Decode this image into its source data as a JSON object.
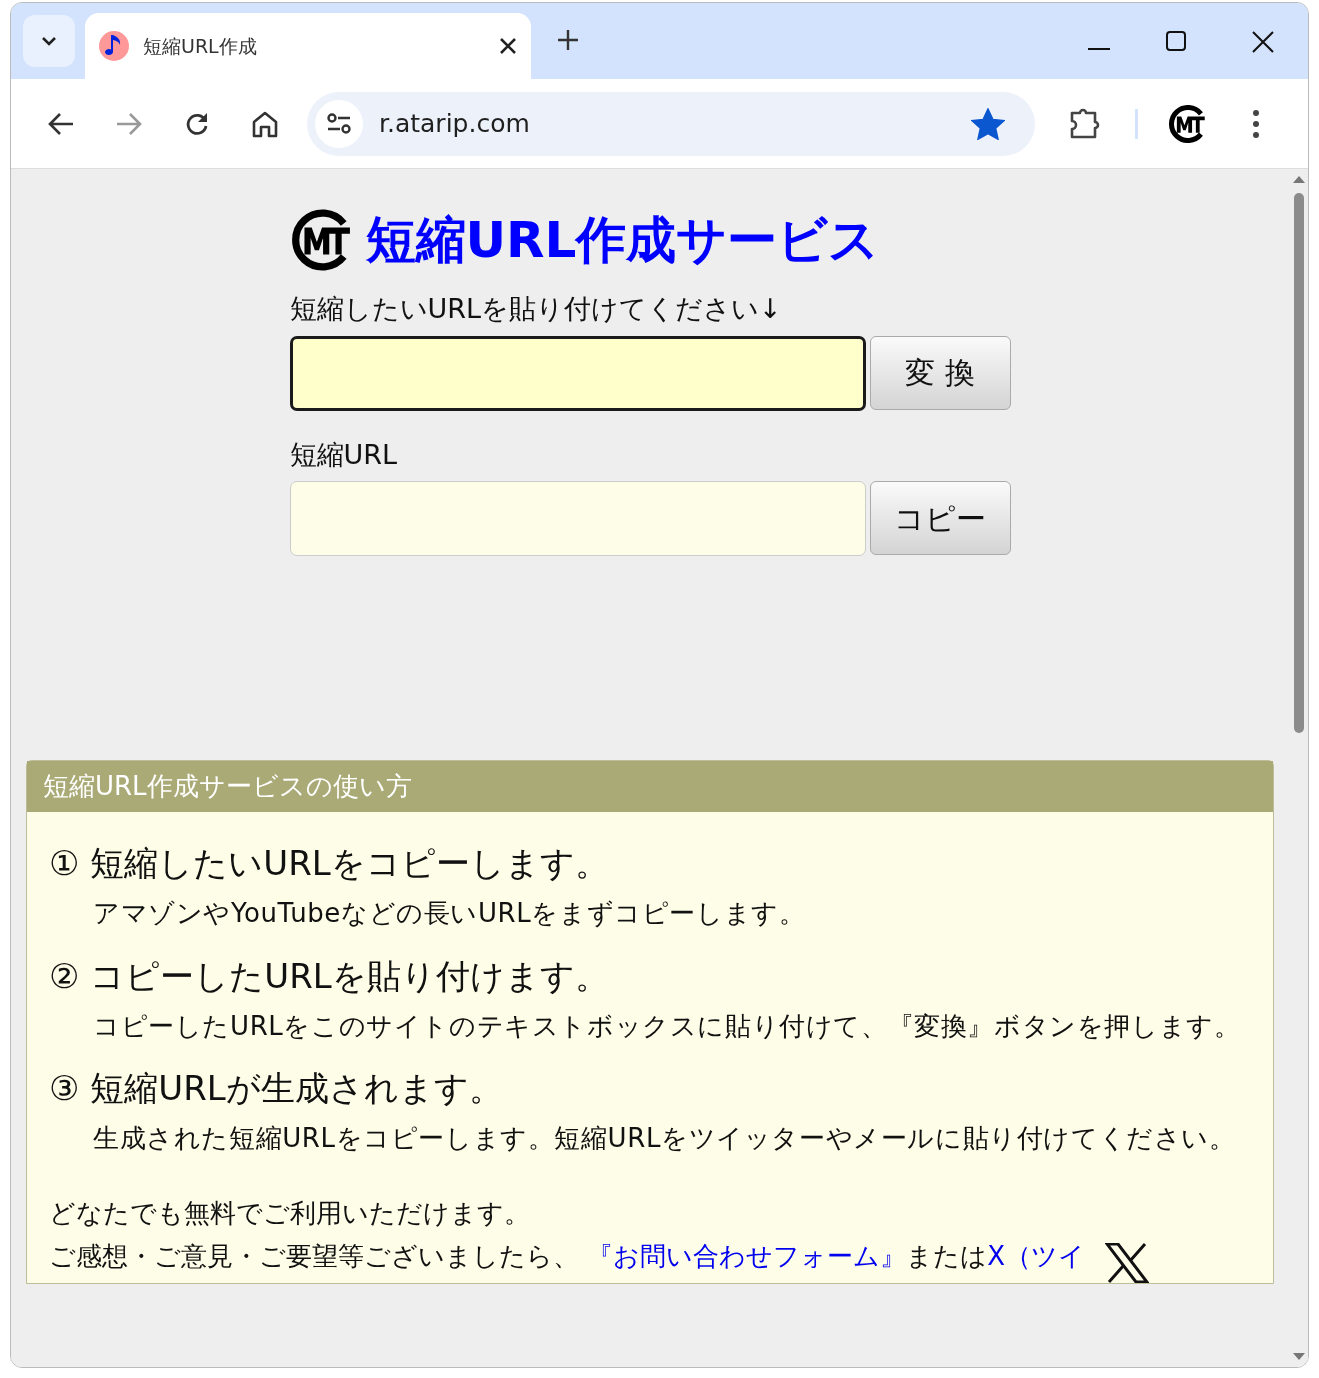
{
  "browser": {
    "tab": {
      "title": "短縮URL作成"
    },
    "address": "r.atarip.com",
    "bookmarked": true
  },
  "page": {
    "title": "短縮URL作成サービス",
    "input_label": "短縮したいURLを貼り付けてください↓",
    "convert_button": "変 換",
    "output_label": "短縮URL",
    "copy_button": "コピー"
  },
  "howto": {
    "heading": "短縮URL作成サービスの使い方",
    "steps": [
      {
        "number": "①",
        "title": "短縮したいURLをコピーします。",
        "body": "アマゾンやYouTubeなどの長いURLをまずコピーします。"
      },
      {
        "number": "②",
        "title": "コピーしたURLを貼り付けます。",
        "body": "コピーしたURLをこのサイトのテキストボックスに貼り付けて、『変換』ボタンを押します。"
      },
      {
        "number": "③",
        "title": "短縮URLが生成されます。",
        "body": "生成された短縮URLをコピーします。短縮URLをツイッターやメールに貼り付けてください。"
      }
    ],
    "note": "どなたでも無料でご利用いただけます。",
    "contact": {
      "text": "ご感想・ご意見・ご要望等ございましたら、",
      "form_link": "『お問い合わせフォーム』",
      "joiner": "または",
      "x_link": "X（ツイ"
    }
  }
}
